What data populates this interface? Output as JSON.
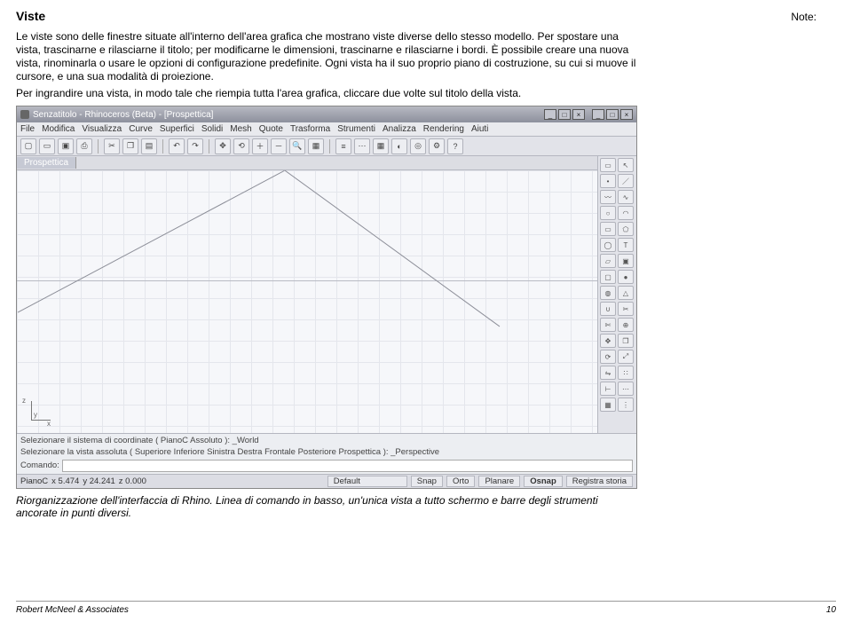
{
  "note_label": "Note:",
  "section_title": "Viste",
  "para1": "Le viste sono delle finestre situate all'interno dell'area grafica che mostrano viste diverse dello stesso modello. Per spostare una vista, trascinarne e rilasciarne il titolo; per modificarne le dimensioni, trascinarne e rilasciarne i bordi. È possibile creare una nuova vista, rinominarla o usare le opzioni di configurazione predefinite. Ogni vista ha il suo proprio piano di costruzione, su cui si muove il cursore, e una sua modalità di proiezione.",
  "para2": "Per ingrandire una vista, in modo tale che riempia tutta l'area grafica, cliccare due volte sul titolo della vista.",
  "caption": "Riorganizzazione dell'interfaccia di Rhino. Linea di comando in basso, un'unica vista a tutto schermo e barre degli strumenti ancorate in punti diversi.",
  "footer_left": "Robert McNeel & Associates",
  "footer_right": "10",
  "rhino": {
    "title": "Senzatitolo - Rhinoceros (Beta) - [Prospettica]",
    "menu": [
      "File",
      "Modifica",
      "Visualizza",
      "Curve",
      "Superfici",
      "Solidi",
      "Mesh",
      "Quote",
      "Trasforma",
      "Strumenti",
      "Analizza",
      "Rendering",
      "Aiuti"
    ],
    "viewport_label": "Prospettica",
    "cmd1": "Selezionare il sistema di coordinate ( PianoC Assoluto ): _World",
    "cmd2": "Selezionare la vista assoluta ( Superiore Inferiore Sinistra Destra Frontale Posteriore Prospettica ): _Perspective",
    "cmd_prompt": "Comando:",
    "status": {
      "plane": "PianoC",
      "x": "x 5.474",
      "y": "y 24.241",
      "z": "z 0.000",
      "layer": "Default",
      "snap": "Snap",
      "orto": "Orto",
      "planare": "Planare",
      "osnap": "Osnap",
      "registra": "Registra storia"
    },
    "winbtns": {
      "min": "_",
      "max": "□",
      "close": "×"
    }
  },
  "axes": {
    "x": "x",
    "y": "y",
    "z": "z"
  }
}
